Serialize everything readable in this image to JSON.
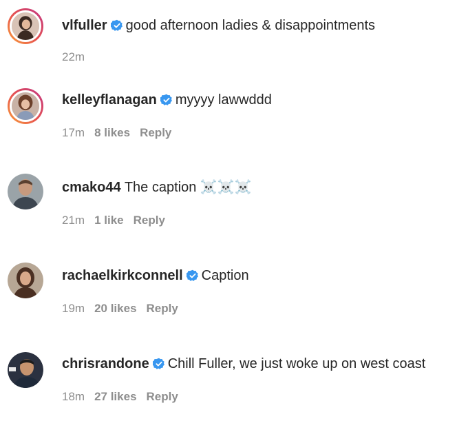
{
  "comments": [
    {
      "username": "vlfuller",
      "verified": true,
      "text": "good afternoon ladies & disappointments",
      "time": "22m",
      "likes": "",
      "reply": "",
      "avatar": "avatar-vlfuller",
      "avatar_ring": true
    },
    {
      "username": "kelleyflanagan",
      "verified": true,
      "text": "myyyy lawwddd",
      "time": "17m",
      "likes": "8 likes",
      "reply": "Reply",
      "avatar": "avatar-kelleyflanagan",
      "avatar_ring": true
    },
    {
      "username": "cmako44",
      "verified": false,
      "text": "The caption ☠️☠️☠️",
      "time": "21m",
      "likes": "1 like",
      "reply": "Reply",
      "avatar": "avatar-cmako44",
      "avatar_ring": false
    },
    {
      "username": "rachaelkirkconnell",
      "verified": true,
      "text": "Caption",
      "time": "19m",
      "likes": "20 likes",
      "reply": "Reply",
      "avatar": "avatar-rachaelkirkconnell",
      "avatar_ring": false
    },
    {
      "username": "chrisrandone",
      "verified": true,
      "text": "Chill Fuller, we just woke up on west coast",
      "time": "18m",
      "likes": "27 likes",
      "reply": "Reply",
      "avatar": "avatar-chrisrandone",
      "avatar_ring": false
    }
  ],
  "colors": {
    "text": "#262626",
    "meta": "#8e8e8e",
    "verified": "#3897f0"
  }
}
